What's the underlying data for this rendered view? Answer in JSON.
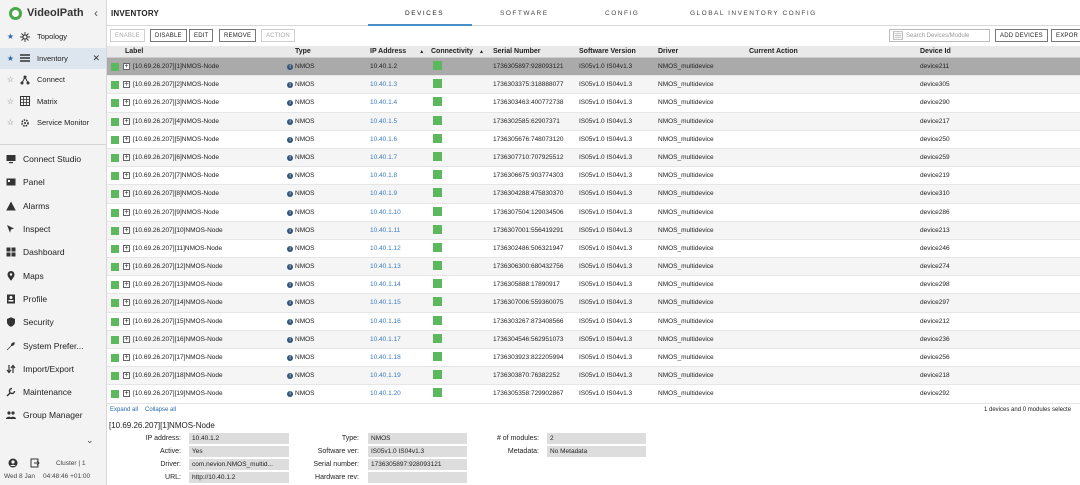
{
  "app": {
    "name": "VideoIPath"
  },
  "sidebar": {
    "favorites": [
      {
        "label": "Topology",
        "icon": "topology-icon",
        "starred": true,
        "active": false
      },
      {
        "label": "Inventory",
        "icon": "list-icon",
        "starred": true,
        "active": true,
        "closable": true
      },
      {
        "label": "Connect",
        "icon": "connect-icon",
        "starred": false,
        "active": false
      },
      {
        "label": "Matrix",
        "icon": "matrix-icon",
        "starred": false,
        "active": false
      },
      {
        "label": "Service Monitor",
        "icon": "gear-icon",
        "starred": false,
        "active": false
      }
    ],
    "nav": [
      {
        "label": "Connect Studio",
        "icon": "monitor-icon"
      },
      {
        "label": "Panel",
        "icon": "panel-icon"
      },
      {
        "label": "Alarms",
        "icon": "alarm-icon"
      },
      {
        "label": "Inspect",
        "icon": "inspect-icon"
      },
      {
        "label": "Dashboard",
        "icon": "dashboard-icon"
      },
      {
        "label": "Maps",
        "icon": "map-pin-icon"
      },
      {
        "label": "Profile",
        "icon": "profile-icon"
      },
      {
        "label": "Security",
        "icon": "shield-icon"
      },
      {
        "label": "System Prefer...",
        "icon": "wrench-icon"
      },
      {
        "label": "Import/Export",
        "icon": "import-export-icon"
      },
      {
        "label": "Maintenance",
        "icon": "maintenance-icon"
      },
      {
        "label": "Group Manager",
        "icon": "group-icon"
      }
    ],
    "footer": {
      "cluster": "Cluster | 1",
      "date": "Wed 8 Jan",
      "time": "04:48:46 +01:00"
    }
  },
  "header": {
    "title": "INVENTORY",
    "tabs": [
      "DEVICES",
      "SOFTWARE",
      "CONFIG",
      "GLOBAL INVENTORY CONFIG"
    ]
  },
  "toolbar": {
    "enable": "ENABLE",
    "disable": "DISABLE",
    "edit": "EDIT",
    "remove": "REMOVE",
    "action": "ACTION",
    "search_placeholder": "Search Devices/Module",
    "add_devices": "ADD DEVICES",
    "export": "EXPOR"
  },
  "table": {
    "headers": {
      "label": "Label",
      "type": "Type",
      "ip": "IP Address",
      "connectivity": "Connectivity",
      "serial": "Serial Number",
      "software": "Software Version",
      "driver": "Driver",
      "action": "Current Action",
      "device_id": "Device Id"
    },
    "rows": [
      {
        "label": "[10.69.26.207][1]NMOS-Node",
        "type": "NMOS",
        "ip": "10.40.1.2",
        "serial": "1736305897:928093121",
        "software": "IS05v1.0 IS04v1.3",
        "driver": "NMOS_multidevice",
        "action": "",
        "device_id": "device211"
      },
      {
        "label": "[10.69.26.207][2]NMOS-Node",
        "type": "NMOS",
        "ip": "10.40.1.3",
        "serial": "1736303375:318888077",
        "software": "IS05v1.0 IS04v1.3",
        "driver": "NMOS_multidevice",
        "action": "",
        "device_id": "device305"
      },
      {
        "label": "[10.69.26.207][3]NMOS-Node",
        "type": "NMOS",
        "ip": "10.40.1.4",
        "serial": "1736303463:400772738",
        "software": "IS05v1.0 IS04v1.3",
        "driver": "NMOS_multidevice",
        "action": "",
        "device_id": "device290"
      },
      {
        "label": "[10.69.26.207][4]NMOS-Node",
        "type": "NMOS",
        "ip": "10.40.1.5",
        "serial": "1736302585:62907371",
        "software": "IS05v1.0 IS04v1.3",
        "driver": "NMOS_multidevice",
        "action": "",
        "device_id": "device217"
      },
      {
        "label": "[10.69.26.207][5]NMOS-Node",
        "type": "NMOS",
        "ip": "10.40.1.6",
        "serial": "1736305676:748073120",
        "software": "IS05v1.0 IS04v1.3",
        "driver": "NMOS_multidevice",
        "action": "",
        "device_id": "device250"
      },
      {
        "label": "[10.69.26.207][6]NMOS-Node",
        "type": "NMOS",
        "ip": "10.40.1.7",
        "serial": "1736307710:707925512",
        "software": "IS05v1.0 IS04v1.3",
        "driver": "NMOS_multidevice",
        "action": "",
        "device_id": "device259"
      },
      {
        "label": "[10.69.26.207][7]NMOS-Node",
        "type": "NMOS",
        "ip": "10.40.1.8",
        "serial": "1736306675:903774303",
        "software": "IS05v1.0 IS04v1.3",
        "driver": "NMOS_multidevice",
        "action": "",
        "device_id": "device219"
      },
      {
        "label": "[10.69.26.207][8]NMOS-Node",
        "type": "NMOS",
        "ip": "10.40.1.9",
        "serial": "1736304288:475830370",
        "software": "IS05v1.0 IS04v1.3",
        "driver": "NMOS_multidevice",
        "action": "",
        "device_id": "device310"
      },
      {
        "label": "[10.69.26.207][9]NMOS-Node",
        "type": "NMOS",
        "ip": "10.40.1.10",
        "serial": "1736307504:129034506",
        "software": "IS05v1.0 IS04v1.3",
        "driver": "NMOS_multidevice",
        "action": "",
        "device_id": "device286"
      },
      {
        "label": "[10.69.26.207][10]NMOS-Node",
        "type": "NMOS",
        "ip": "10.40.1.11",
        "serial": "1736307001:556419291",
        "software": "IS05v1.0 IS04v1.3",
        "driver": "NMOS_multidevice",
        "action": "",
        "device_id": "device213"
      },
      {
        "label": "[10.69.26.207][11]NMOS-Node",
        "type": "NMOS",
        "ip": "10.40.1.12",
        "serial": "1736302486:506321947",
        "software": "IS05v1.0 IS04v1.3",
        "driver": "NMOS_multidevice",
        "action": "",
        "device_id": "device246"
      },
      {
        "label": "[10.69.26.207][12]NMOS-Node",
        "type": "NMOS",
        "ip": "10.40.1.13",
        "serial": "1736306300:680432756",
        "software": "IS05v1.0 IS04v1.3",
        "driver": "NMOS_multidevice",
        "action": "",
        "device_id": "device274"
      },
      {
        "label": "[10.69.26.207][13]NMOS-Node",
        "type": "NMOS",
        "ip": "10.40.1.14",
        "serial": "1736305888:17890917",
        "software": "IS05v1.0 IS04v1.3",
        "driver": "NMOS_multidevice",
        "action": "",
        "device_id": "device298"
      },
      {
        "label": "[10.69.26.207][14]NMOS-Node",
        "type": "NMOS",
        "ip": "10.40.1.15",
        "serial": "1736307006:559360075",
        "software": "IS05v1.0 IS04v1.3",
        "driver": "NMOS_multidevice",
        "action": "",
        "device_id": "device297"
      },
      {
        "label": "[10.69.26.207][15]NMOS-Node",
        "type": "NMOS",
        "ip": "10.40.1.16",
        "serial": "1736303267:873408566",
        "software": "IS05v1.0 IS04v1.3",
        "driver": "NMOS_multidevice",
        "action": "",
        "device_id": "device212"
      },
      {
        "label": "[10.69.26.207][16]NMOS-Node",
        "type": "NMOS",
        "ip": "10.40.1.17",
        "serial": "1736304546:562951073",
        "software": "IS05v1.0 IS04v1.3",
        "driver": "NMOS_multidevice",
        "action": "",
        "device_id": "device236"
      },
      {
        "label": "[10.69.26.207][17]NMOS-Node",
        "type": "NMOS",
        "ip": "10.40.1.18",
        "serial": "1736303923:822205994",
        "software": "IS05v1.0 IS04v1.3",
        "driver": "NMOS_multidevice",
        "action": "",
        "device_id": "device256"
      },
      {
        "label": "[10.69.26.207][18]NMOS-Node",
        "type": "NMOS",
        "ip": "10.40.1.19",
        "serial": "1736303870:76382252",
        "software": "IS05v1.0 IS04v1.3",
        "driver": "NMOS_multidevice",
        "action": "",
        "device_id": "device218"
      },
      {
        "label": "[10.69.26.207][19]NMOS-Node",
        "type": "NMOS",
        "ip": "10.40.1.20",
        "serial": "1736305358:729902867",
        "software": "IS05v1.0 IS04v1.3",
        "driver": "NMOS_multidevice",
        "action": "",
        "device_id": "device292"
      }
    ],
    "expand_all": "Expand all",
    "collapse_all": "Collapse all",
    "selection_status": "1 devices and 0 modules selecte"
  },
  "details": {
    "title": "[10.69.26.207][1]NMOS-Node",
    "ip_label": "IP address:",
    "ip": "10.40.1.2",
    "active_label": "Active:",
    "active": "Yes",
    "driver_label": "Driver:",
    "driver": "com.nevion.NMOS_multid...",
    "url_label": "URL:",
    "url": "http://10.40.1.2",
    "type_label": "Type:",
    "type": "NMOS",
    "software_label": "Software ver:",
    "software": "IS05v1.0 IS04v1.3",
    "serial_label": "Serial number:",
    "serial": "1736305897:928093121",
    "hardware_label": "Hardware rev:",
    "hardware": "",
    "modules_label": "# of modules:",
    "modules": "2",
    "metadata_label": "Metadata:",
    "metadata": "No Metadata"
  },
  "colors": {
    "accent": "#4a90c8",
    "status_green": "#5cb85c",
    "selected_row": "#aaaaaa",
    "link": "#3a7cc0"
  }
}
